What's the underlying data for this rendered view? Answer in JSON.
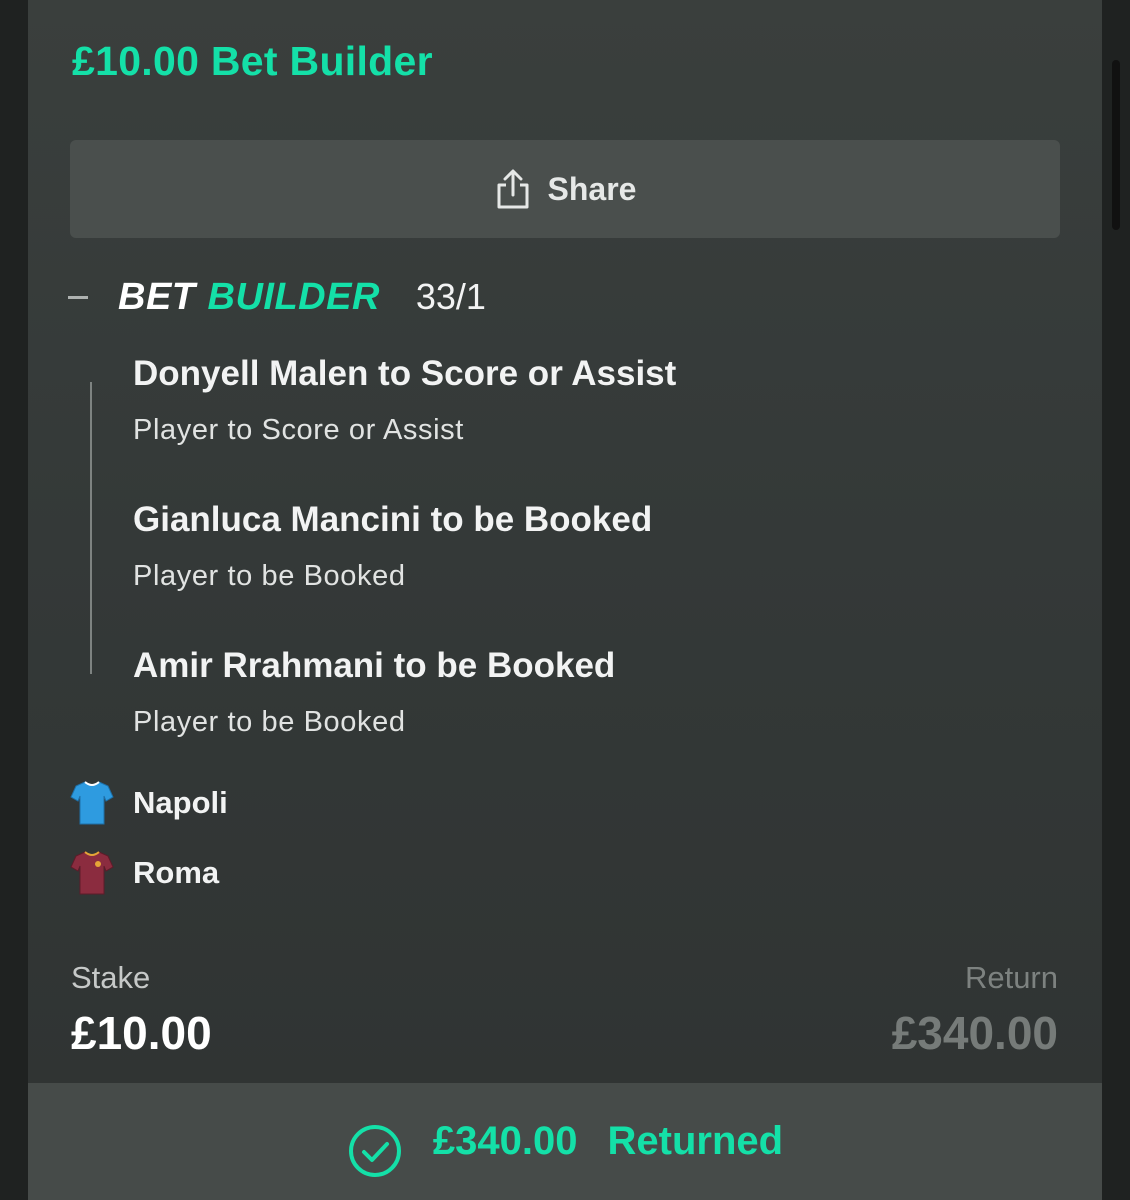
{
  "header": {
    "title": "£10.00 Bet Builder"
  },
  "share": {
    "label": "Share",
    "icon": "share-icon"
  },
  "bet_builder": {
    "logo_word1": "BET",
    "logo_word2": "BUILDER",
    "odds": "33/1",
    "collapse_icon": "minus-icon",
    "selections": [
      {
        "name": "Donyell Malen to Score or Assist",
        "market": "Player to Score or Assist"
      },
      {
        "name": "Gianluca Mancini to be Booked",
        "market": "Player to be Booked"
      },
      {
        "name": "Amir Rrahmani to be Booked",
        "market": "Player to be Booked"
      }
    ]
  },
  "teams": [
    {
      "name": "Napoli",
      "icon": "shirt-icon",
      "shirt_color": "#2e9be0"
    },
    {
      "name": "Roma",
      "icon": "shirt-icon",
      "shirt_color": "#8b2c3f"
    }
  ],
  "stake": {
    "label": "Stake",
    "value": "£10.00"
  },
  "return": {
    "label": "Return",
    "value": "£340.00"
  },
  "status": {
    "icon": "check-circle-icon",
    "amount": "£340.00",
    "text": "Returned"
  },
  "colors": {
    "accent": "#14e0a8",
    "card_bg": "#363b3a",
    "status_bar_bg": "#464b49"
  }
}
